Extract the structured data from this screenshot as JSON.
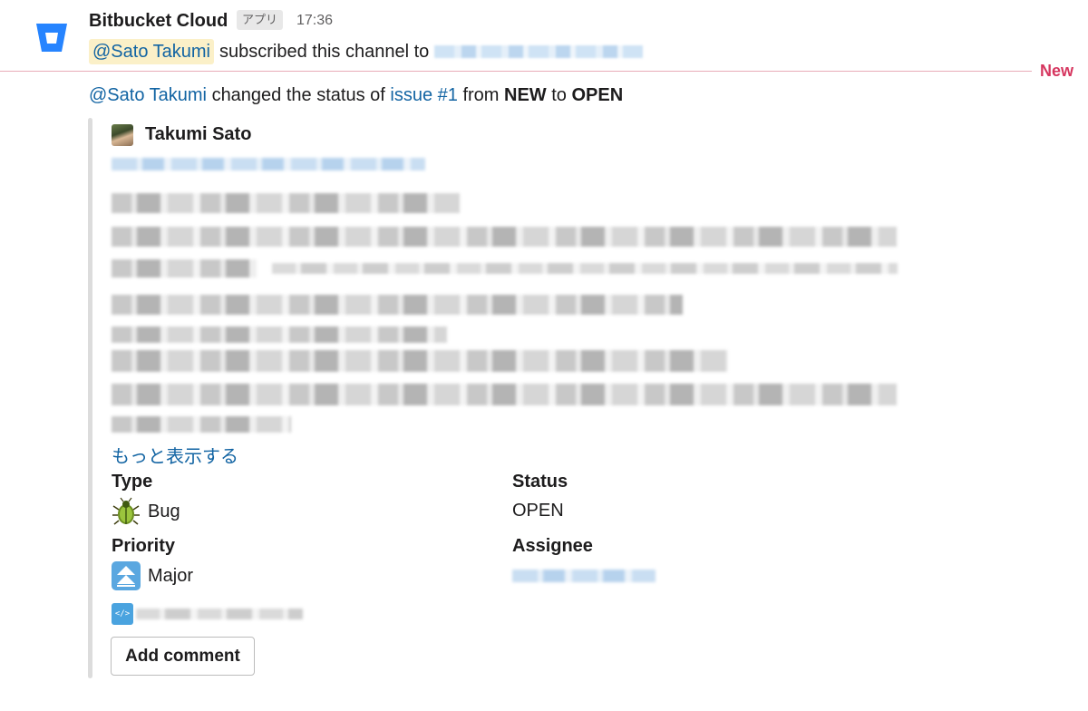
{
  "message1": {
    "sender": "Bitbucket Cloud",
    "badge": "アプリ",
    "time": "17:36",
    "mention": "@Sato Takumi",
    "text": "subscribed this channel to"
  },
  "divider": {
    "label": "New"
  },
  "message2": {
    "mention": "@Sato Takumi",
    "text_a": "changed the status of",
    "issue_link": "issue #1",
    "text_b": "from",
    "from_status": "NEW",
    "text_c": "to",
    "to_status": "OPEN"
  },
  "attachment": {
    "author": "Takumi Sato",
    "show_more": "もっと表示する",
    "fields": {
      "type_label": "Type",
      "type_value": "Bug",
      "status_label": "Status",
      "status_value": "OPEN",
      "priority_label": "Priority",
      "priority_value": "Major",
      "assignee_label": "Assignee"
    },
    "code_icon": "</>",
    "add_comment": "Add comment"
  },
  "colors": {
    "link": "#1264a3",
    "new_divider": "#d6365f",
    "mention_highlight": "#fbf0c8",
    "bitbucket_blue": "#2684ff"
  },
  "icons": {
    "app": "bitbucket-logo-icon",
    "type": "beetle-icon",
    "priority": "double-up-arrow-icon",
    "repo": "code-icon"
  }
}
